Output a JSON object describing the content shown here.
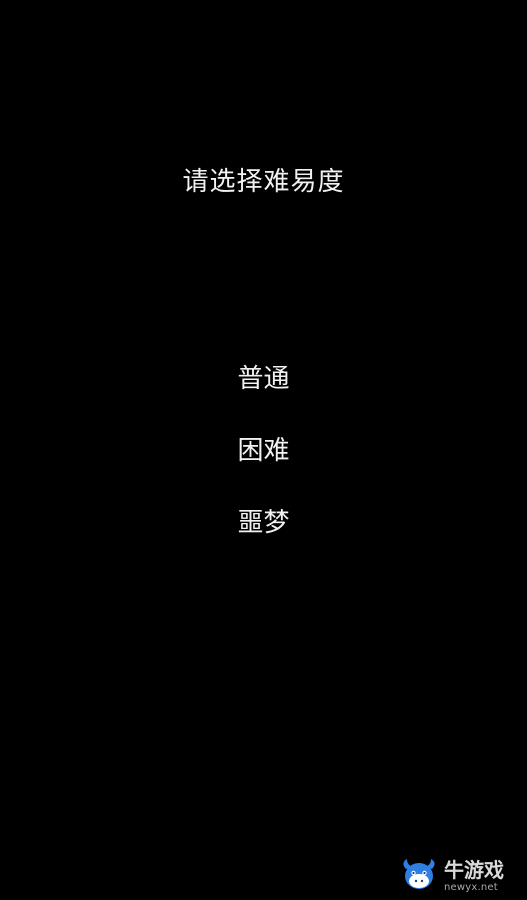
{
  "screen": {
    "title": "请选择难易度"
  },
  "difficulty": {
    "options": [
      {
        "label": "普通"
      },
      {
        "label": "困难"
      },
      {
        "label": "噩梦"
      }
    ]
  },
  "watermark": {
    "brand": "牛游戏",
    "domain": "newyx.net",
    "mascot_icon": "bull-mascot-icon",
    "colors": {
      "mascot_blue": "#2f7ee3",
      "mascot_white": "#ffffff",
      "text_light": "#d9d9d9"
    }
  },
  "colors": {
    "background": "#000000",
    "text": "#f2f2f2"
  }
}
